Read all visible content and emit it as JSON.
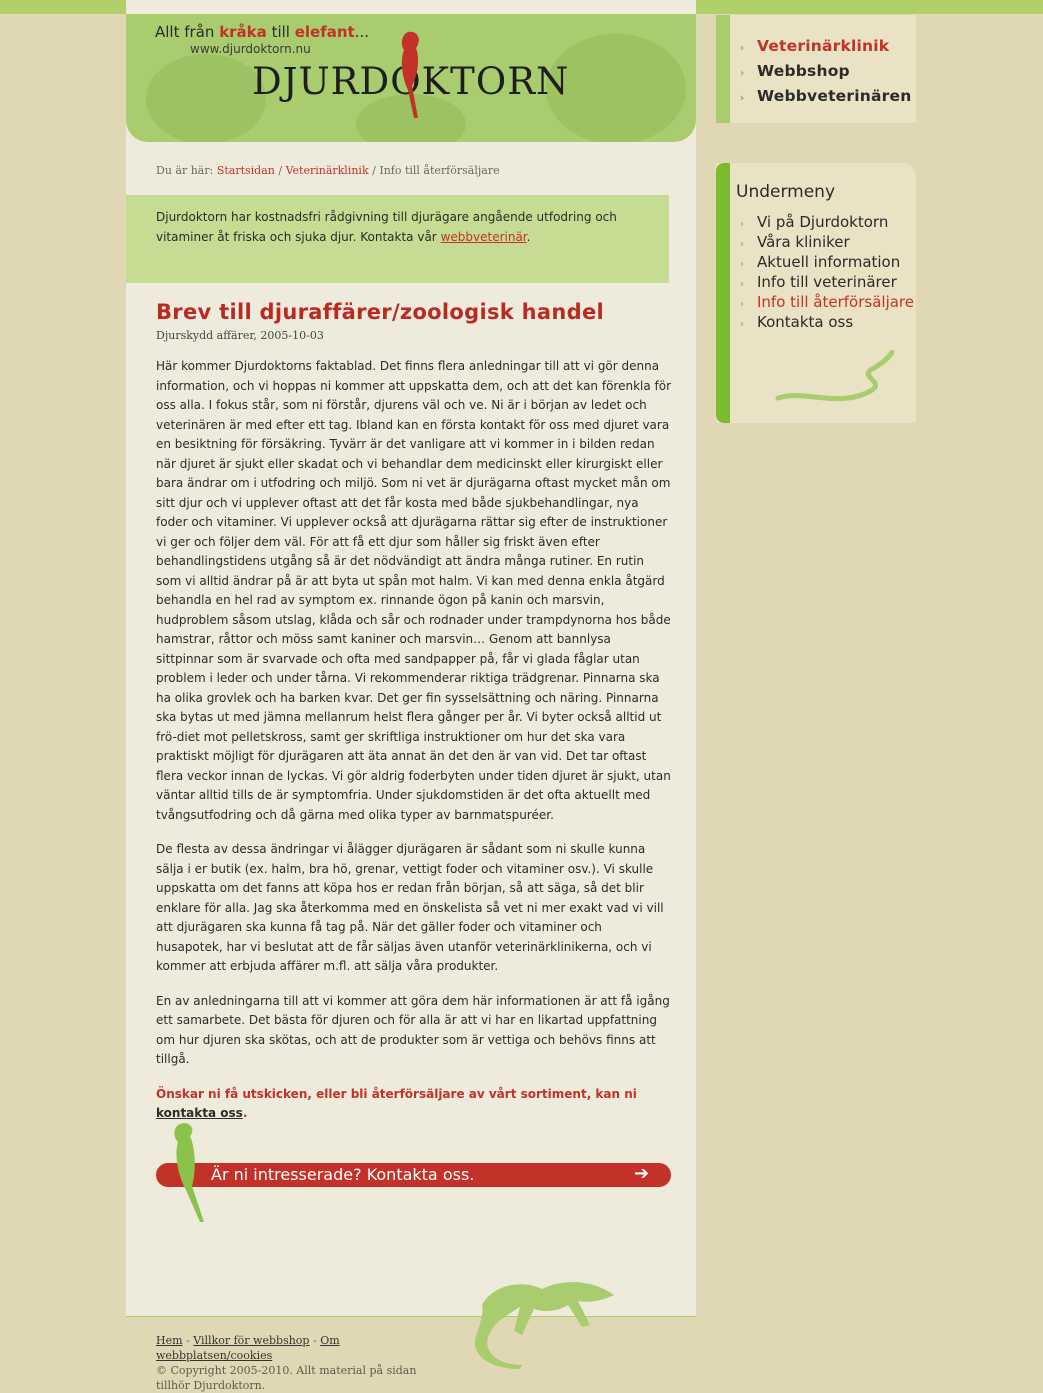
{
  "header": {
    "slogan_pre": "Allt från",
    "slogan_w1": "kråka",
    "slogan_mid": "till",
    "slogan_w2": "elefant",
    "slogan_end": "...",
    "url": "www.djurdoktorn.nu",
    "logo": "DJURDOKTORN"
  },
  "nav": {
    "items": [
      {
        "label": "Veterinärklinik"
      },
      {
        "label": "Webbshop"
      },
      {
        "label": "Webbveterinären"
      }
    ]
  },
  "submenu": {
    "title": "Undermeny",
    "items": [
      {
        "label": "Vi på Djurdoktorn"
      },
      {
        "label": "Våra kliniker"
      },
      {
        "label": "Aktuell information"
      },
      {
        "label": "Info till veterinärer"
      },
      {
        "label": "Info till återförsäljare"
      },
      {
        "label": "Kontakta oss"
      }
    ]
  },
  "breadcrumb": {
    "prefix": "Du är här:",
    "home": "Startsidan",
    "sep1": "/",
    "section": "Veterinärklinik",
    "sep2": "/",
    "current": "Info till återförsäljare"
  },
  "intro": {
    "text": "Djurdoktorn har kostnadsfri rådgivning till djurägare angående utfodring och vitaminer åt friska och sjuka djur. Kontakta vår",
    "link": "webbveterinär",
    "end": "."
  },
  "article": {
    "title": "Brev till djuraffärer/zoologisk handel",
    "meta": "Djurskydd affärer, 2005-10-03",
    "p1": "Här kommer Djurdoktorns faktablad. Det finns flera anledningar till att vi gör denna information, och vi hoppas ni kommer att uppskatta dem, och att det kan förenkla för oss alla. I fokus står, som ni förstår, djurens väl och ve. Ni är i början av ledet och veterinären är med efter ett tag. Ibland kan en första kontakt för oss med djuret vara en besiktning för försäkring. Tyvärr är det vanligare att vi kommer in i bilden redan när djuret är sjukt eller skadat och vi behandlar dem medicinskt eller kirurgiskt eller bara ändrar om i utfodring och miljö. Som ni vet är djurägarna oftast mycket mån om sitt djur och vi upplever oftast att det får kosta med både sjukbehandlingar, nya foder och vitaminer. Vi upplever också att djurägarna rättar sig efter de instruktioner vi ger och följer dem väl. För att få ett djur som håller sig friskt även efter behandlingstidens utgång så är det nödvändigt att ändra många rutiner. En rutin som vi alltid ändrar på är att byta ut spån mot halm. Vi kan med denna enkla åtgärd behandla en hel rad av symptom ex. rinnande ögon på kanin och marsvin, hudproblem såsom utslag, klåda och sår och rodnader under trampdynorna hos både hamstrar, råttor och möss samt kaniner och marsvin… Genom att bannlysa sittpinnar som är svarvade och ofta med sandpapper på, får vi glada fåglar utan problem i leder och under tårna. Vi rekommenderar riktiga trädgrenar. Pinnarna ska ha olika grovlek och ha barken kvar. Det ger fin sysselsättning och näring. Pinnarna ska bytas ut med jämna mellanrum helst flera gånger per år. Vi byter också alltid ut frö-diet mot pelletskross, samt ger skriftliga instruktioner om hur det ska vara praktiskt möjligt för djurägaren att äta annat än det den är van vid. Det tar oftast flera veckor innan de lyckas. Vi gör aldrig foderbyten under tiden djuret är sjukt, utan väntar alltid tills de är symptomfria. Under sjukdomstiden är det ofta aktuellt med tvångsutfodring och då gärna med olika typer av barnmatspuréer.",
    "p2": "De flesta av dessa ändringar vi ålägger djurägaren är sådant som ni skulle kunna sälja i er butik (ex. halm, bra hö, grenar, vettigt foder och vitaminer osv.). Vi skulle uppskatta om det fanns att köpa hos er redan från början, så att säga, så det blir enklare för alla. Jag ska återkomma med en önskelista så vet ni mer exakt vad vi vill att djurägaren ska kunna få tag på. När det gäller foder och vitaminer och husapotek, har vi beslutat att de får säljas även utanför veterinärklinikerna, och vi kommer att erbjuda affärer m.fl. att sälja våra produkter.",
    "p3": "En av anledningarna till att vi kommer att göra dem här informationen är att få igång ett samarbete. Det bästa för djuren och för alla är att vi har en likartad uppfattning om hur djuren ska skötas, och att de produkter som är vettiga och behövs finns att tillgå.",
    "cta_text": "Önskar ni få utskicken, eller bli återförsäljare av vårt sortiment, kan ni",
    "cta_link": "kontakta oss",
    "cta_end": "."
  },
  "contact_bar": {
    "label": "Är ni intresserade? Kontakta oss.",
    "arrow": "➔"
  },
  "footer": {
    "hem": "Hem",
    "sep": "-",
    "villkor": "Villkor för webbshop",
    "om": "Om webbplatsen/cookies",
    "copyright": "© Copyright 2005-2010. Allt material på sidan tillhör Djurdoktorn."
  },
  "colors": {
    "brand_red": "#c23228",
    "green": "#a8cc6e",
    "bg": "#e0d8b4"
  }
}
